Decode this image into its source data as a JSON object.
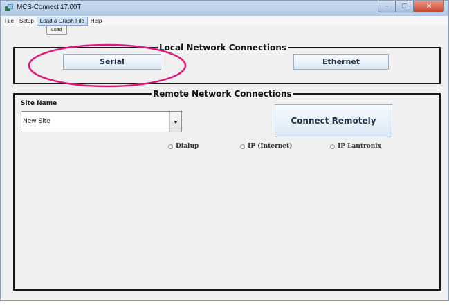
{
  "window": {
    "title": "MCS-Connect 17.00T",
    "controls": {
      "minimize": "–",
      "maximize": "□",
      "close": "✕"
    }
  },
  "menu": {
    "items": [
      "File",
      "Setup",
      "Load a Graph File",
      "Help"
    ],
    "active_index": 2,
    "dropdown_items": [
      "Load"
    ]
  },
  "local": {
    "title": "Local Network Connections",
    "serial_label": "Serial",
    "ethernet_label": "Ethernet"
  },
  "remote": {
    "title": "Remote Network Connections",
    "site_label": "Site Name",
    "site_value": "New Site",
    "connect_label": "Connect Remotely",
    "options": [
      "Dialup",
      "IP (Internet)",
      "IP Lantronix"
    ]
  },
  "colors": {
    "highlight": "#e0187c",
    "button_text": "#1d3048"
  }
}
